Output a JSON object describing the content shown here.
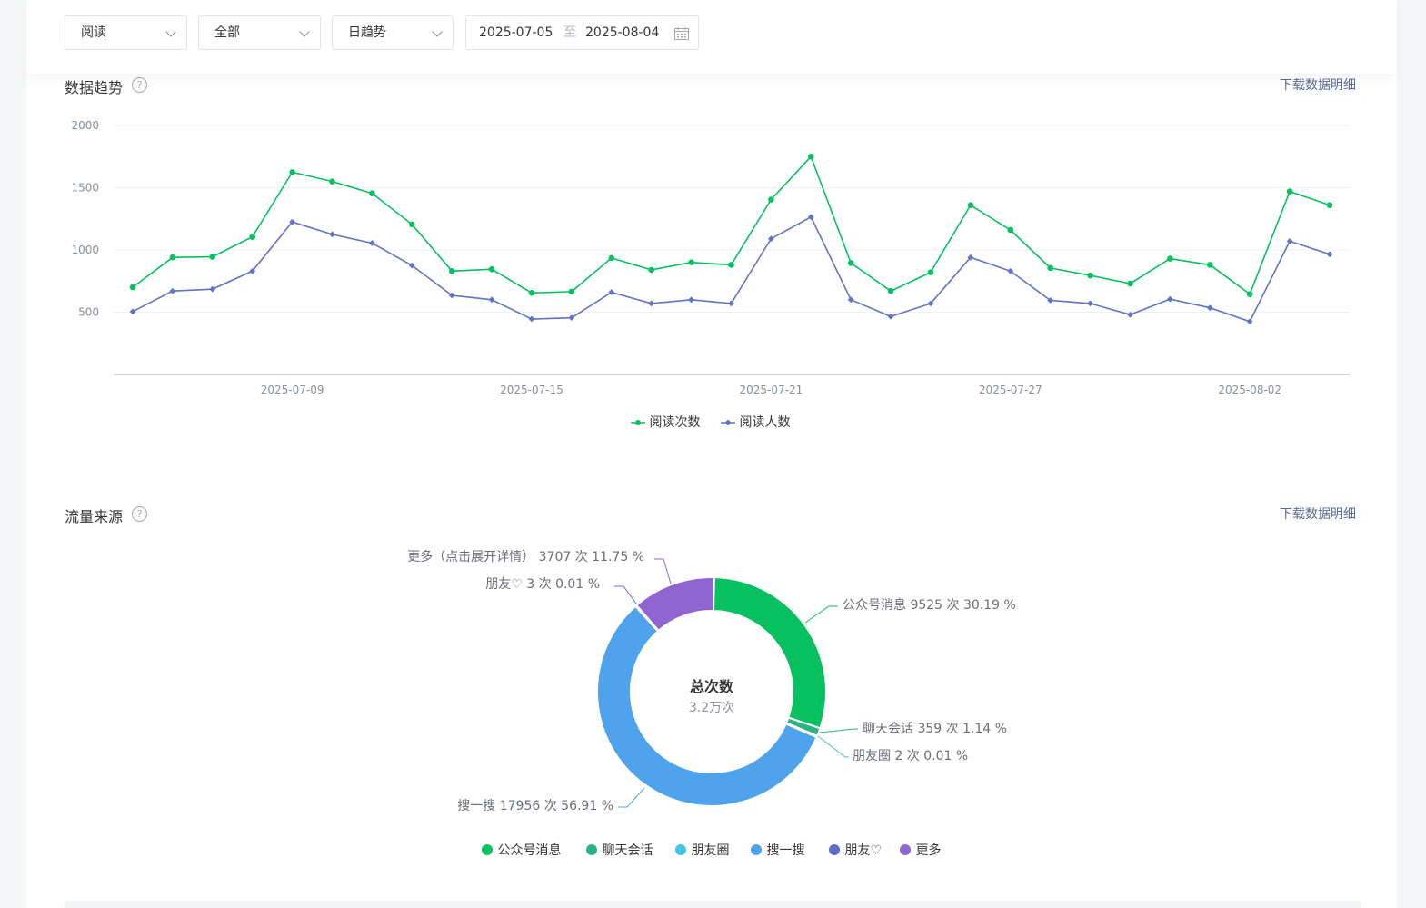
{
  "filters": {
    "metric": "阅读",
    "scope": "全部",
    "trend": "日趋势",
    "date_start": "2025-07-05",
    "date_sep": "至",
    "date_end": "2025-08-04"
  },
  "trend_section": {
    "title": "数据趋势",
    "help": "?",
    "download_label": "下载数据明细",
    "legend": [
      "阅读次数",
      "阅读人数"
    ]
  },
  "source_section": {
    "title": "流量来源",
    "help": "?",
    "download_label": "下载数据明细",
    "center_title": "总次数",
    "center_value": "3.2万次",
    "slice_labels": [
      "公众号消息 9525 次 30.19 %",
      "聊天会话 359 次 1.14 %",
      "朋友圈 2 次 0.01 %",
      "搜一搜 17956 次 56.91 %",
      "朋友♡ 3 次 0.01 %",
      "更多（点击展开详情） 3707 次 11.75 %"
    ],
    "legend": [
      "公众号消息",
      "聊天会话",
      "朋友圈",
      "搜一搜",
      "朋友♡",
      "更多"
    ]
  },
  "colors": {
    "read_count": "#07c160",
    "read_users": "#6174c3",
    "official_msg": "#07c160",
    "chat": "#2fb283",
    "moments": "#41c6e4",
    "search": "#4fa3ec",
    "friends": "#5b6fc9",
    "more": "#9065d1",
    "link": "#576b95"
  },
  "chart_data": [
    {
      "type": "line",
      "x": [
        "2025-07-05",
        "2025-07-06",
        "2025-07-07",
        "2025-07-08",
        "2025-07-09",
        "2025-07-10",
        "2025-07-11",
        "2025-07-12",
        "2025-07-13",
        "2025-07-14",
        "2025-07-15",
        "2025-07-16",
        "2025-07-17",
        "2025-07-18",
        "2025-07-19",
        "2025-07-20",
        "2025-07-21",
        "2025-07-22",
        "2025-07-23",
        "2025-07-24",
        "2025-07-25",
        "2025-07-26",
        "2025-07-27",
        "2025-07-28",
        "2025-07-29",
        "2025-07-30",
        "2025-07-31",
        "2025-08-01",
        "2025-08-02",
        "2025-08-03",
        "2025-08-04"
      ],
      "xticks": [
        "2025-07-09",
        "2025-07-15",
        "2025-07-21",
        "2025-07-27",
        "2025-08-02"
      ],
      "yticks": [
        500,
        1000,
        1500,
        2000
      ],
      "ylim": [
        0,
        2000
      ],
      "series": [
        {
          "name": "阅读次数",
          "values": [
            700,
            940,
            945,
            1105,
            1625,
            1550,
            1455,
            1205,
            830,
            845,
            655,
            665,
            935,
            840,
            900,
            880,
            1405,
            1750,
            895,
            670,
            820,
            1360,
            1160,
            855,
            795,
            730,
            930,
            880,
            645,
            1470,
            1360
          ]
        },
        {
          "name": "阅读人数",
          "values": [
            505,
            670,
            685,
            830,
            1225,
            1125,
            1055,
            875,
            635,
            600,
            445,
            455,
            660,
            570,
            600,
            570,
            1090,
            1265,
            600,
            465,
            570,
            940,
            830,
            595,
            570,
            480,
            605,
            535,
            425,
            1070,
            965
          ]
        }
      ]
    },
    {
      "type": "pie",
      "categories": [
        "公众号消息",
        "聊天会话",
        "朋友圈",
        "搜一搜",
        "朋友♡",
        "更多"
      ],
      "values": [
        9525,
        359,
        2,
        17956,
        3,
        3707
      ],
      "percents": [
        30.19,
        1.14,
        0.01,
        56.91,
        0.01,
        11.75
      ]
    }
  ]
}
